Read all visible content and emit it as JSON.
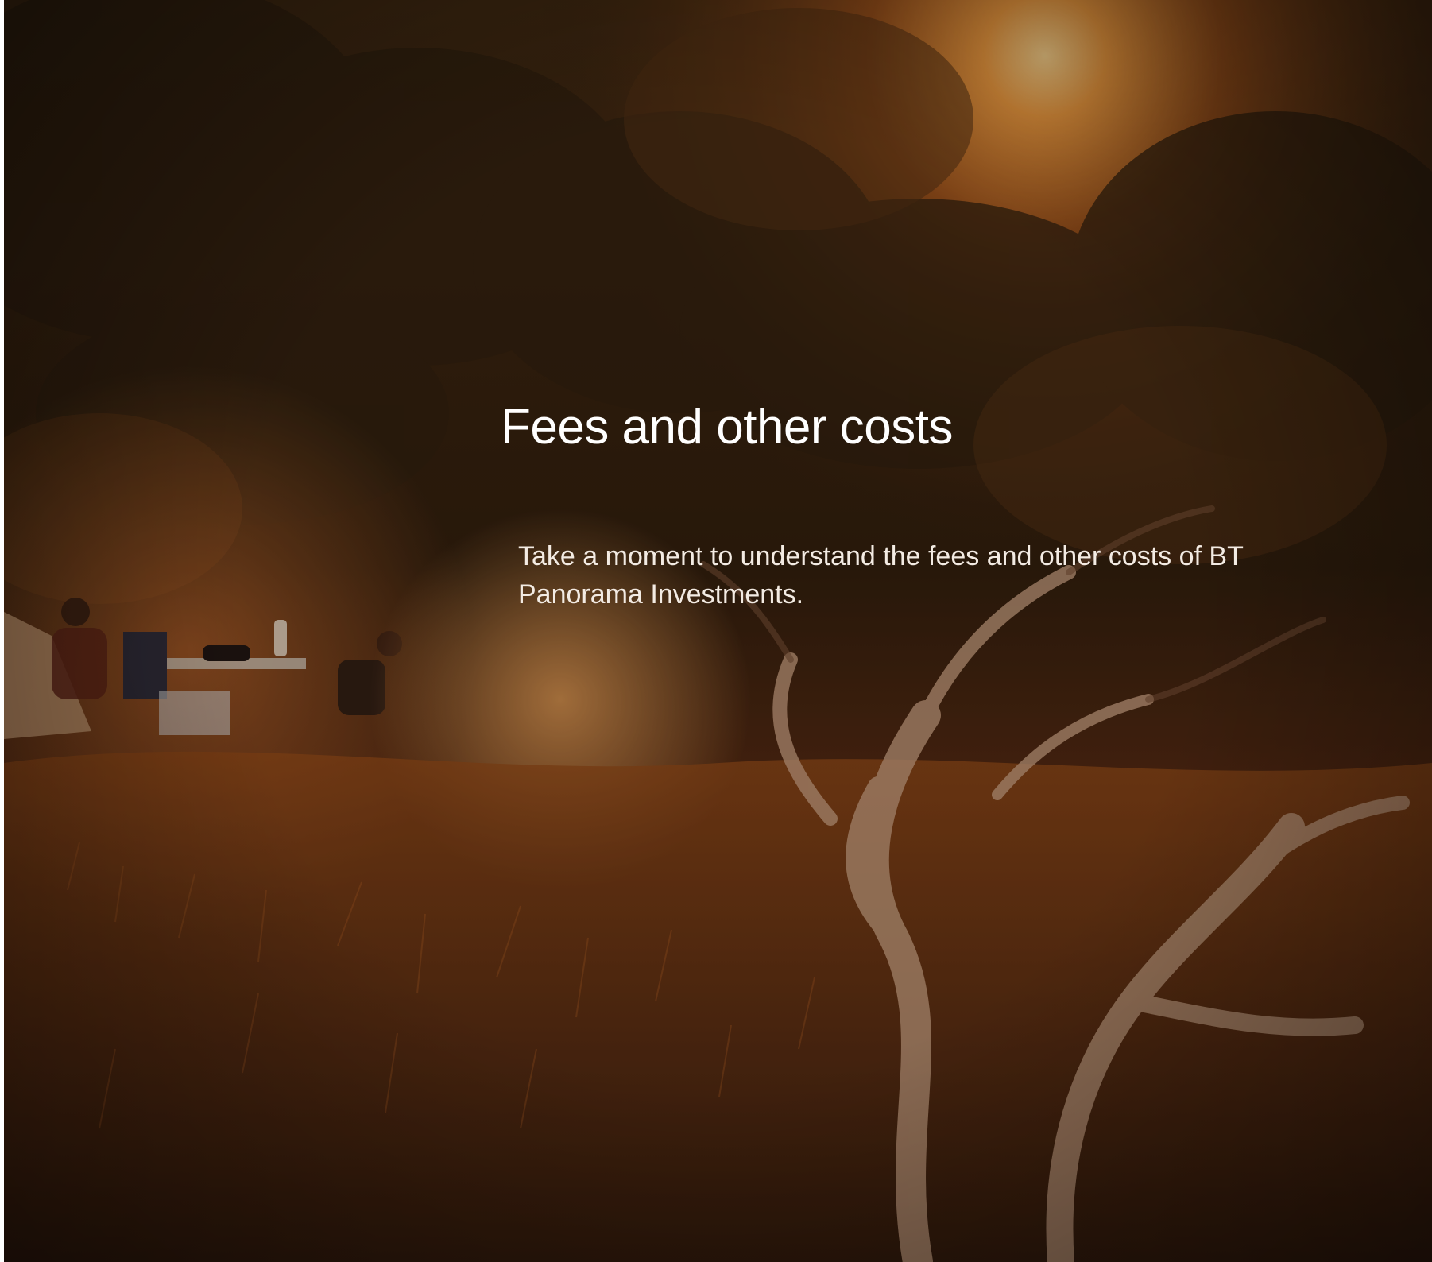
{
  "cover": {
    "title": "Fees and other costs",
    "intro": "Take a moment to understand the fees and other costs of BT Panorama Investments."
  },
  "background": {
    "description_icon": "sunset-bushland-photo",
    "colors": {
      "sky_glow": "#f6b45a",
      "foliage_dark": "#2a1a0c",
      "grass_amber": "#7a3e14",
      "bark_pale": "#c9a88a"
    }
  }
}
